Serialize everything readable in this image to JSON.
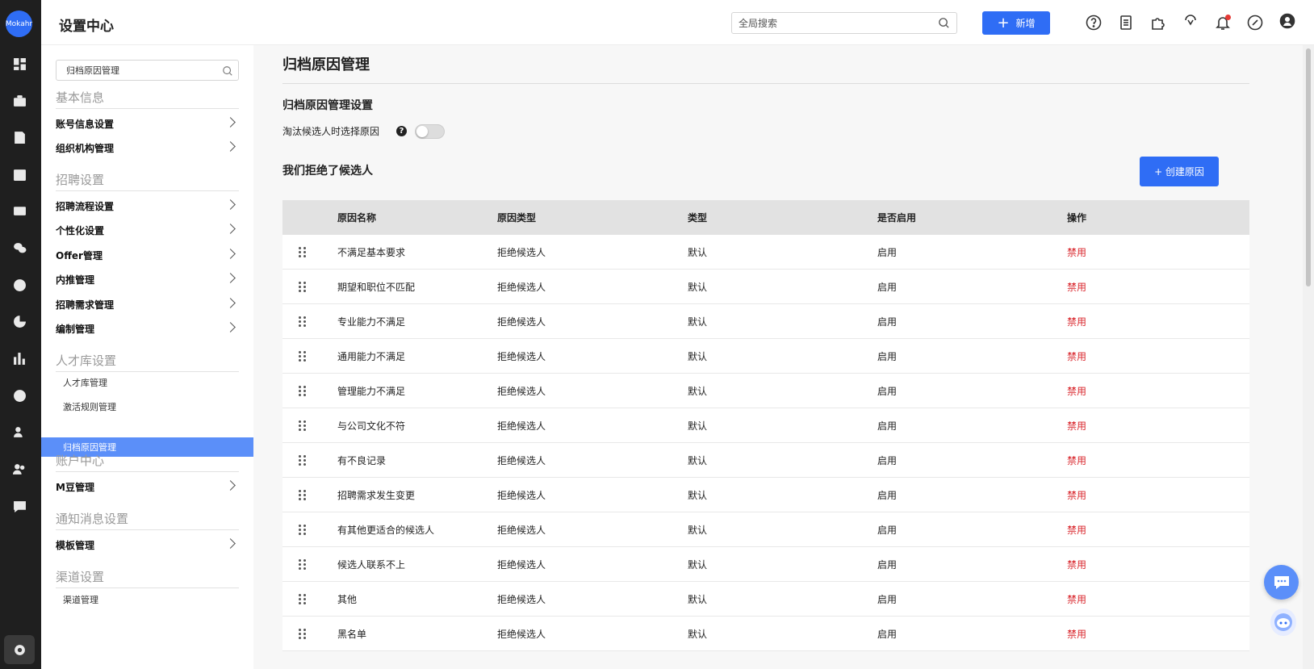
{
  "app": {
    "logo_text": "Mokahr",
    "title": "设置中心"
  },
  "topbar": {
    "search_placeholder": "全局搜索",
    "new_button": "新增",
    "icons": [
      "help-icon",
      "document-icon",
      "puzzle-icon",
      "service-icon",
      "bell-icon",
      "link-icon",
      "user-icon"
    ]
  },
  "rail": {
    "icons": [
      "dashboard-icon",
      "briefcase-icon",
      "resume-icon",
      "calendar-icon",
      "id-card-icon",
      "wechat-icon",
      "thumb-up-icon",
      "pie-chart-icon",
      "bar-chart-icon",
      "talent-icon",
      "people-icon",
      "team-icon",
      "message-icon",
      "settings-icon"
    ]
  },
  "sidebar": {
    "search_value": "归档原因管理",
    "groups": [
      {
        "title": "基本信息",
        "items": [
          "账号信息设置",
          "组织机构管理"
        ]
      },
      {
        "title": "招聘设置",
        "items": [
          "招聘流程设置",
          "个性化设置",
          "Offer管理",
          "内推管理",
          "招聘需求管理",
          "编制管理"
        ]
      },
      {
        "title": "人才库设置",
        "subs": [
          "人才库管理",
          "激活规则管理"
        ],
        "active": "归档原因管理"
      },
      {
        "title": "账户中心",
        "items": [
          "M豆管理"
        ]
      },
      {
        "title": "通知消息设置",
        "items": [
          "模板管理"
        ]
      },
      {
        "title": "渠道设置",
        "subs": [
          "渠道管理"
        ]
      }
    ]
  },
  "main": {
    "page_title": "归档原因管理",
    "settings_title": "归档原因管理设置",
    "toggle_label": "淘汰候选人时选择原因",
    "toggle_on": false,
    "reject_title": "我们拒绝了候选人",
    "create_button": "+ 创建原因",
    "columns": [
      "原因名称",
      "原因类型",
      "类型",
      "是否启用",
      "操作"
    ],
    "rows": [
      [
        "不满足基本要求",
        "拒绝候选人",
        "默认",
        "启用",
        "禁用"
      ],
      [
        "期望和职位不匹配",
        "拒绝候选人",
        "默认",
        "启用",
        "禁用"
      ],
      [
        "专业能力不满足",
        "拒绝候选人",
        "默认",
        "启用",
        "禁用"
      ],
      [
        "通用能力不满足",
        "拒绝候选人",
        "默认",
        "启用",
        "禁用"
      ],
      [
        "管理能力不满足",
        "拒绝候选人",
        "默认",
        "启用",
        "禁用"
      ],
      [
        "与公司文化不符",
        "拒绝候选人",
        "默认",
        "启用",
        "禁用"
      ],
      [
        "有不良记录",
        "拒绝候选人",
        "默认",
        "启用",
        "禁用"
      ],
      [
        "招聘需求发生变更",
        "拒绝候选人",
        "默认",
        "启用",
        "禁用"
      ],
      [
        "有其他更适合的候选人",
        "拒绝候选人",
        "默认",
        "启用",
        "禁用"
      ],
      [
        "候选人联系不上",
        "拒绝候选人",
        "默认",
        "启用",
        "禁用"
      ],
      [
        "其他",
        "拒绝候选人",
        "默认",
        "启用",
        "禁用"
      ],
      [
        "黑名单",
        "拒绝候选人",
        "默认",
        "启用",
        "禁用"
      ]
    ]
  },
  "colors": {
    "primary": "#2f6df5",
    "active_item": "#5b8ff9",
    "danger": "#d9262c",
    "rail": "#1f1f1f"
  }
}
